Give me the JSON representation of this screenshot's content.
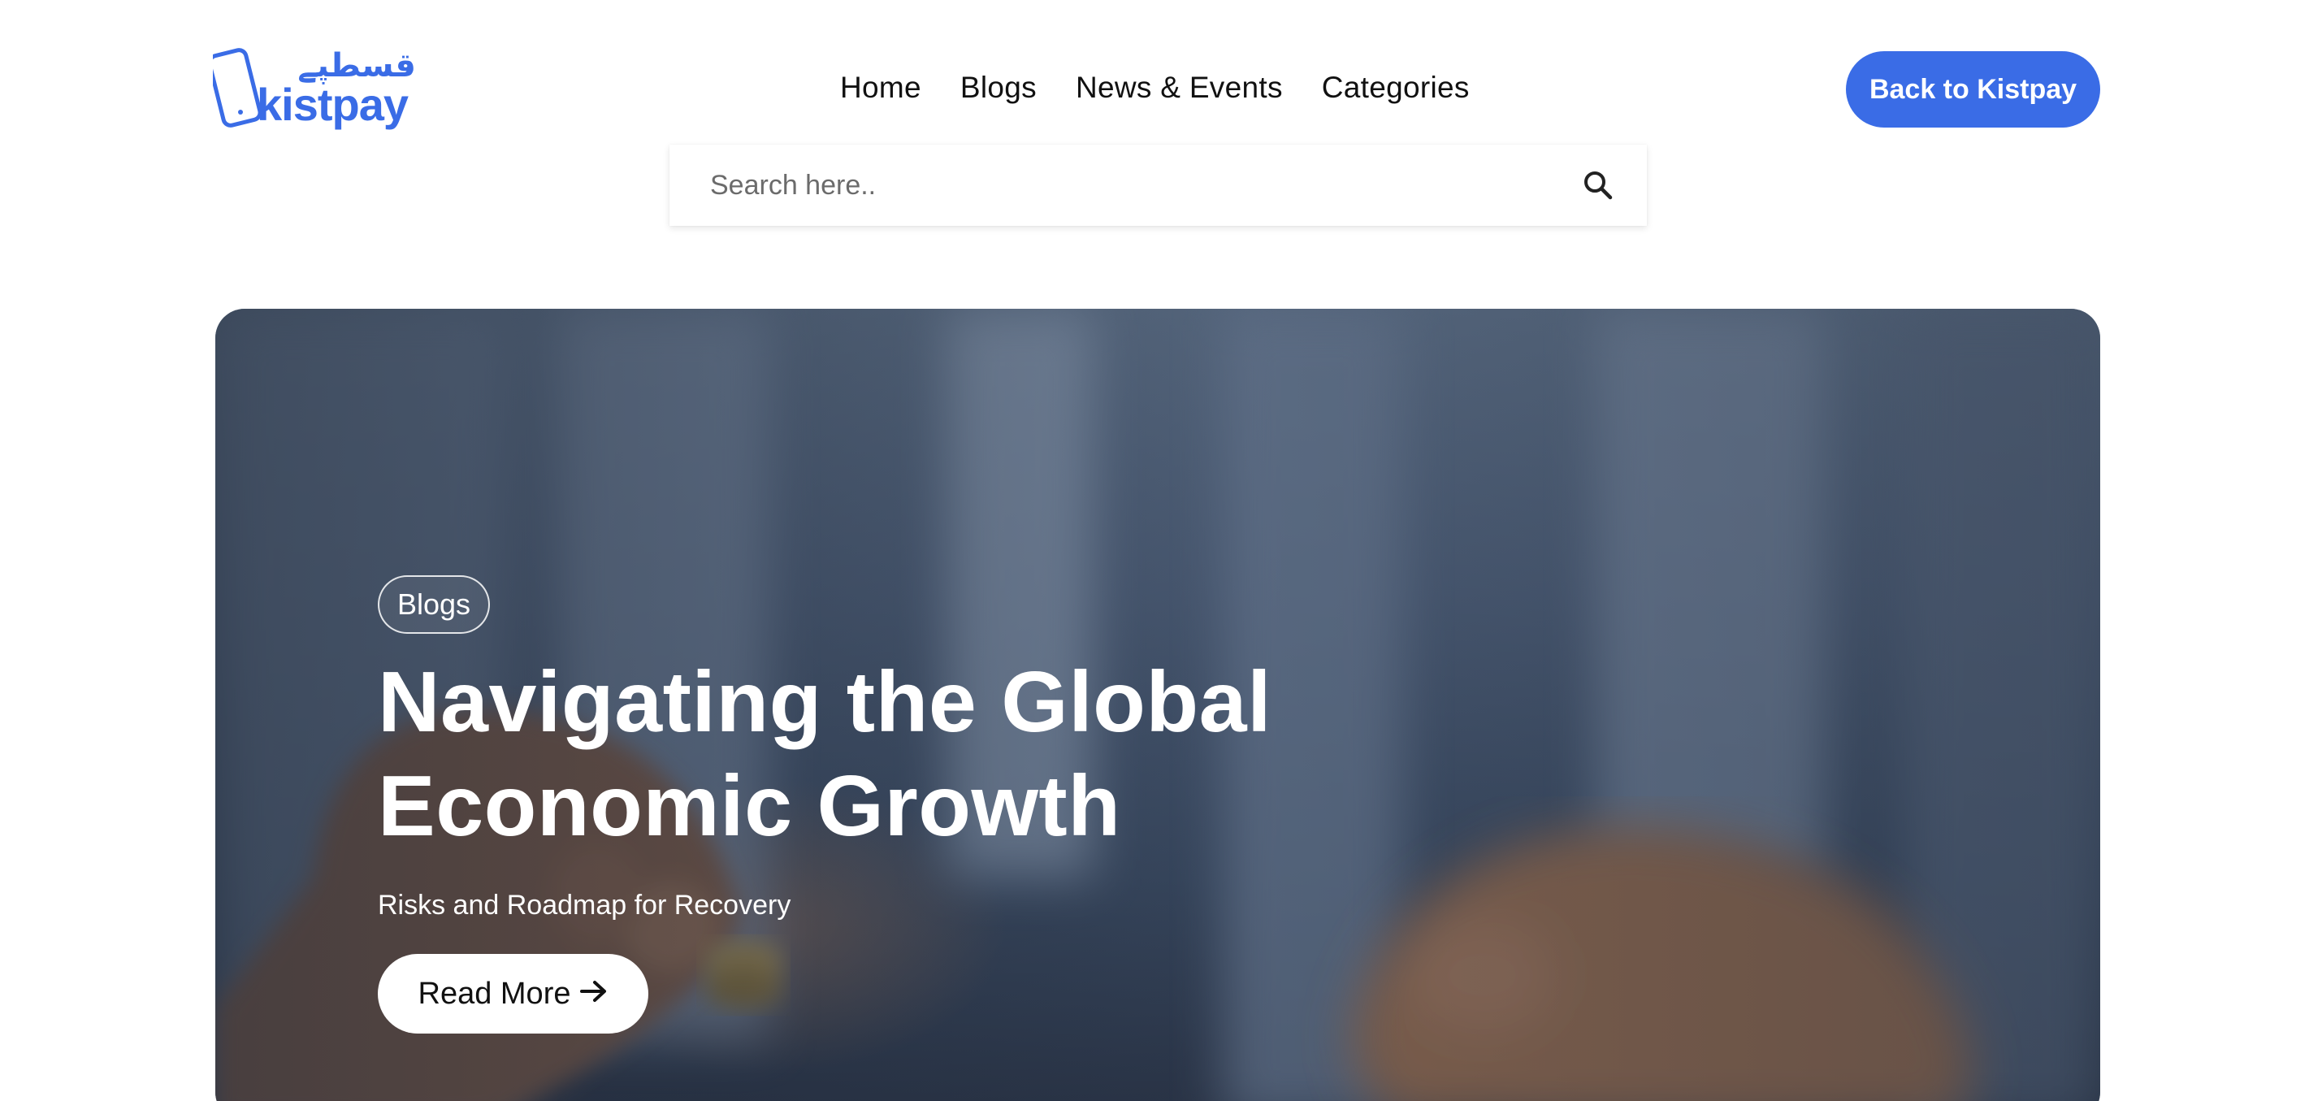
{
  "header": {
    "logo_text_latin": "kistpay",
    "logo_text_urdu": "قسطپے",
    "back_button_label": "Back to Kistpay"
  },
  "nav": {
    "items": [
      {
        "label": "Home"
      },
      {
        "label": "Blogs"
      },
      {
        "label": "News & Events"
      },
      {
        "label": "Categories"
      }
    ]
  },
  "search": {
    "placeholder": "Search here..",
    "value": ""
  },
  "hero": {
    "badge": "Blogs",
    "title_line1": "Navigating the Global",
    "title_line2": "Economic Growth",
    "subtitle": "Risks and Roadmap for Recovery",
    "read_more_label": "Read More",
    "read_more_icon": "→"
  },
  "colors": {
    "brand": "#3a6ce6",
    "nav_text": "#111111",
    "hero_overlay": "#3a4a62"
  },
  "icons": {
    "search": "search-icon",
    "arrow": "arrow-right-icon",
    "logo": "kistpay-logo"
  }
}
